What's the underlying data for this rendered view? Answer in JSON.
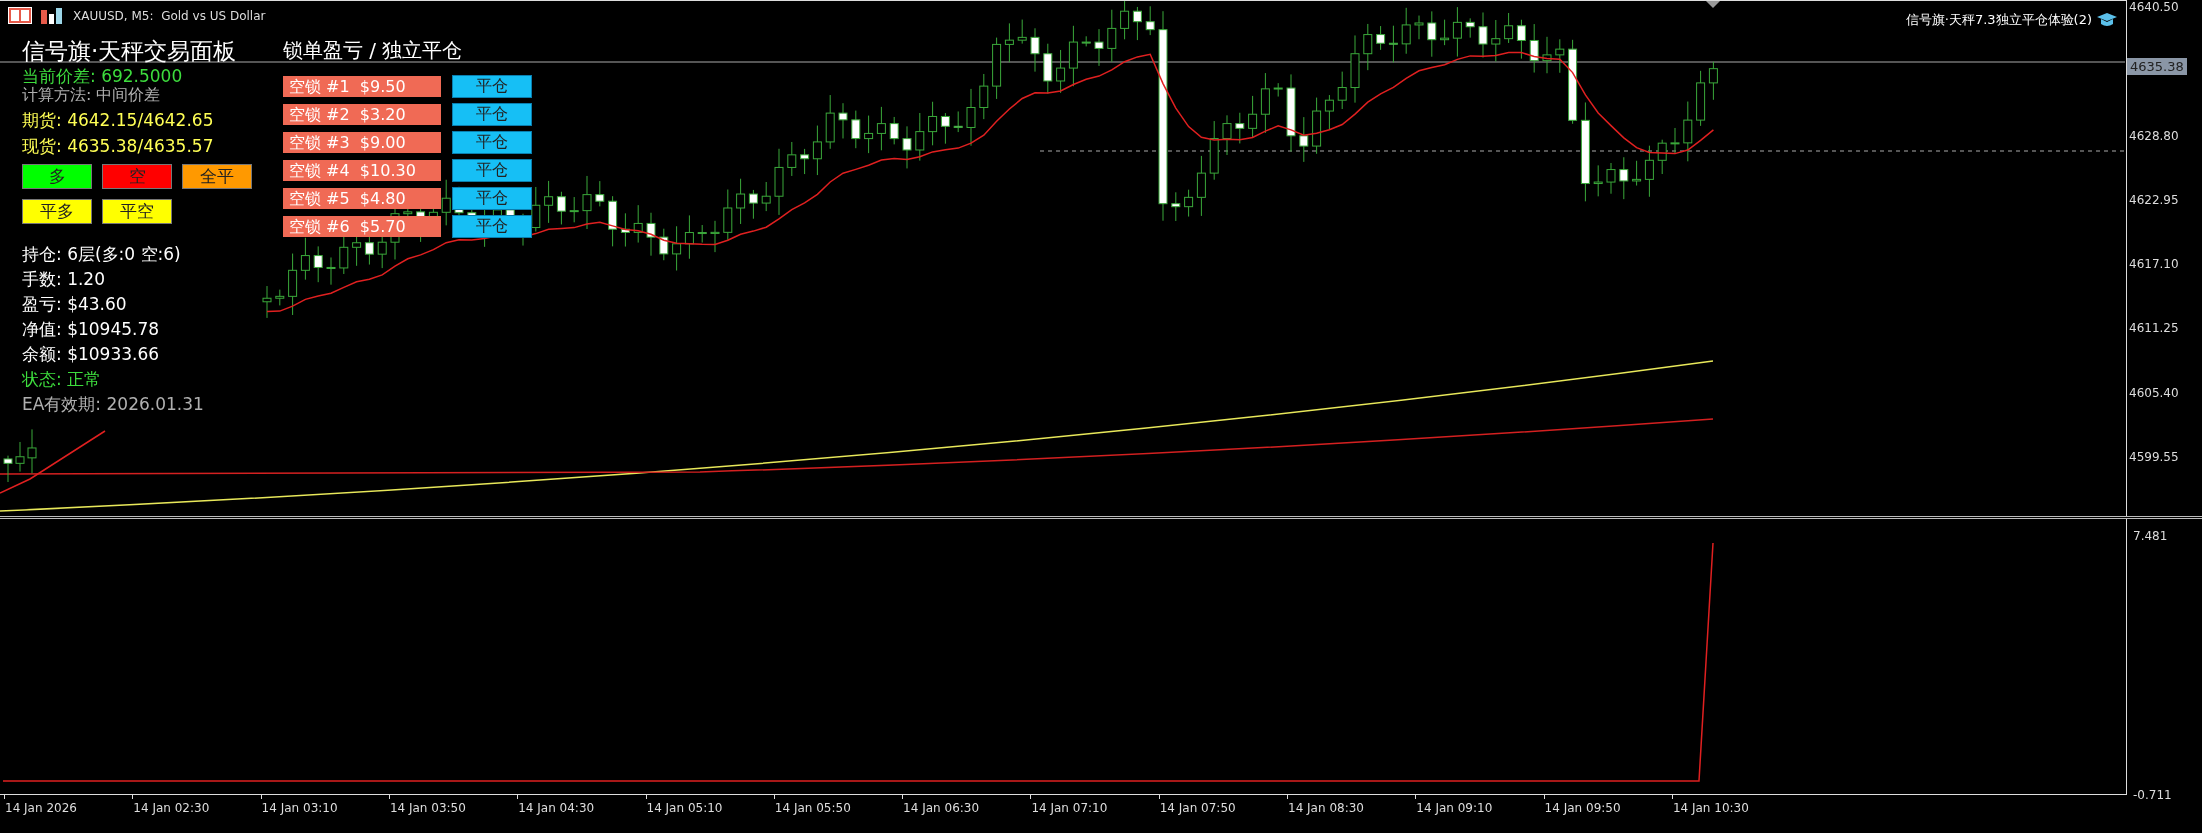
{
  "chart_header": {
    "symbol_title": "XAUUSD, M5:  Gold vs US Dollar",
    "indicator_title": "信号旗·天秤7.3独立平仓体验(2)"
  },
  "panel": {
    "title": "信号旗·天秤交易面板",
    "spread": "当前价差: 692.5000",
    "method": "计算方法: 中间价差",
    "futures": "期货: 4642.15/4642.65",
    "spot": "现货: 4635.38/4635.57",
    "buttons": [
      {
        "label": "多",
        "color": "#00ff00"
      },
      {
        "label": "空",
        "color": "#ff0000"
      },
      {
        "label": "全平",
        "color": "#ff9900"
      }
    ],
    "close_buttons": [
      {
        "label": "平多",
        "color": "#ffff00"
      },
      {
        "label": "平空",
        "color": "#ffff00"
      }
    ],
    "stats": [
      {
        "text": "持仓: 6层(多:0 空:6)",
        "kind": "info"
      },
      {
        "text": "手数: 1.20",
        "kind": "info"
      },
      {
        "text": "盈亏: $43.60",
        "kind": "info"
      },
      {
        "text": "净值: $10945.78",
        "kind": "info"
      },
      {
        "text": "余额: $10933.66",
        "kind": "info"
      },
      {
        "text": "状态: 正常",
        "kind": "status"
      },
      {
        "text": "EA有效期: 2026.01.31",
        "kind": "note"
      }
    ]
  },
  "lock_panel": {
    "title": "锁单盈亏 / 独立平仓",
    "rows": [
      {
        "label": "空锁 #1  $9.50",
        "button": "平仓"
      },
      {
        "label": "空锁 #2  $3.20",
        "button": "平仓"
      },
      {
        "label": "空锁 #3  $9.00",
        "button": "平仓"
      },
      {
        "label": "空锁 #4  $10.30",
        "button": "平仓"
      },
      {
        "label": "空锁 #5  $4.80",
        "button": "平仓"
      },
      {
        "label": "空锁 #6  $5.70",
        "button": "平仓"
      }
    ]
  },
  "price_axis": {
    "labels": [
      "4640.50",
      "4628.80",
      "4622.95",
      "4617.10",
      "4611.25",
      "4605.40",
      "4599.55"
    ],
    "current_price": "4635.38"
  },
  "indicator_axis": {
    "labels": [
      "7.481",
      "-0.711"
    ]
  },
  "time_axis": {
    "labels": [
      "14 Jan 2026",
      "14 Jan 02:30",
      "14 Jan 03:10",
      "14 Jan 03:50",
      "14 Jan 04:30",
      "14 Jan 05:10",
      "14 Jan 05:50",
      "14 Jan 06:30",
      "14 Jan 07:10",
      "14 Jan 07:50",
      "14 Jan 08:30",
      "14 Jan 09:10",
      "14 Jan 09:50",
      "14 Jan 10:30"
    ]
  }
}
